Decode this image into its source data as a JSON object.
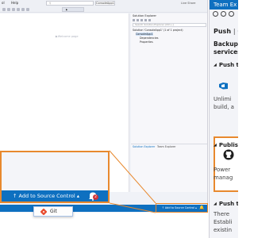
{
  "vs": {
    "menu": [
      "ol",
      "Help"
    ],
    "solution_title": "ConsoleApp1",
    "live_share": "Live Share",
    "editor_watermark": "▶Welcome page",
    "solution_explorer": {
      "title": "Solution Explorer",
      "search_placeholder": "Search Solution Explorer (Ctrl+;)",
      "tree": [
        "Solution 'ConsoleApp1' (1 of 1 project)",
        "ConsoleApp1",
        "Dependencies",
        "Properties"
      ],
      "tabs": [
        "Solution Explorer",
        "Team Explorer"
      ]
    },
    "status_bar": {
      "add_to_source_control": "↑ Add to Source Control ▴",
      "notification_count": "2"
    }
  },
  "zoom": {
    "git_menu_item": "Git",
    "add_to_source_control": "↑  Add to Source Control  ▴",
    "notification_count": "2"
  },
  "team_explorer": {
    "header": "Team Ex",
    "title": "Push",
    "title_sep": "|",
    "title_suffix": "C",
    "description_line1": "Backup",
    "description_line2": "services",
    "push_section": {
      "heading": "Push t",
      "text_line1": "Unlimi",
      "text_line2": "build, a"
    },
    "publish_section": {
      "heading": "Publish",
      "text_line1": "Power",
      "text_line2": "manag"
    },
    "push_section_2": {
      "heading": "Push t",
      "text_line1": "There",
      "text_line2": "Establi",
      "text_line3": "existin"
    }
  },
  "colors": {
    "accent_blue": "#0e70c0",
    "highlight_orange": "#e8892e",
    "badge_red": "#d13438"
  }
}
